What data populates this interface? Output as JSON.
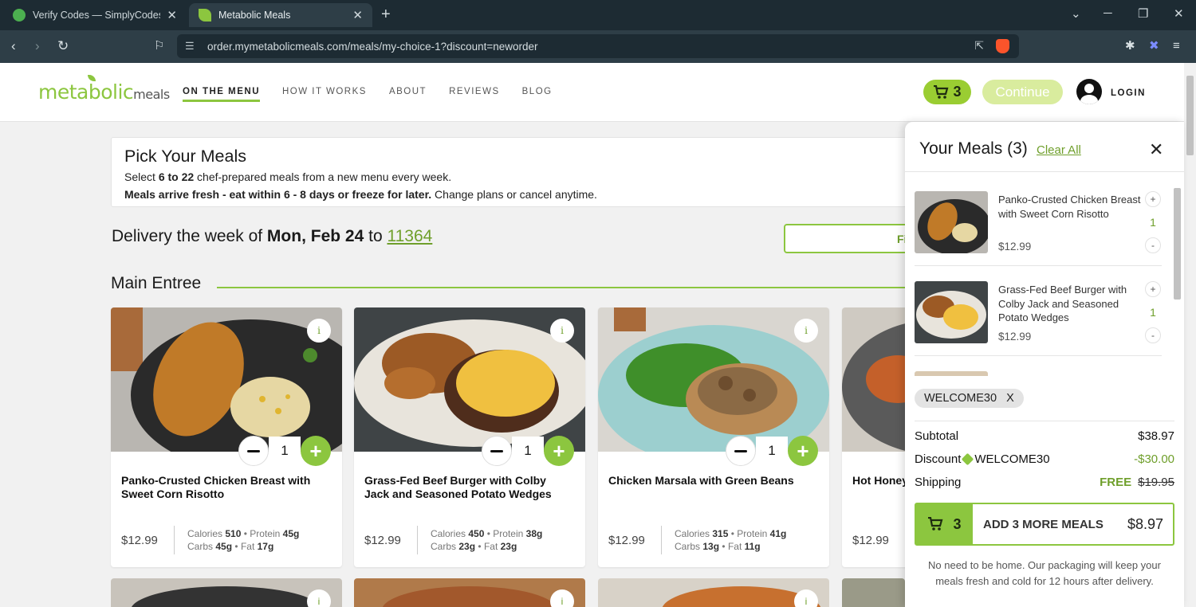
{
  "browser": {
    "tabs": [
      {
        "title": "Verify Codes — SimplyCodes",
        "icon_color": "#4caf50"
      },
      {
        "title": "Metabolic Meals",
        "icon_color": "#8cc63f"
      }
    ],
    "url": "order.mymetabolicmeals.com/meals/my-choice-1?discount=neworder"
  },
  "header": {
    "logo_main": "metabolic",
    "logo_sub": "meals",
    "nav": [
      "ON THE MENU",
      "HOW IT WORKS",
      "ABOUT",
      "REVIEWS",
      "BLOG"
    ],
    "cart_count": "3",
    "continue_label": "Continue",
    "login_label": "LOGIN"
  },
  "intro": {
    "title": "Pick Your Meals",
    "line1_pre": "Select ",
    "line1_bold": "6 to 22",
    "line1_post": " chef-prepared meals from a new menu every week.",
    "line2_bold": "Meals arrive fresh - eat within 6 - 8 days or freeze for later.",
    "line2_post": " Change plans or cancel anytime."
  },
  "delivery": {
    "pre": "Delivery the week of ",
    "date": "Mon, Feb 24",
    "mid": " to ",
    "zip": "11364",
    "filter_label": "Fi"
  },
  "section_title": "Main Entree",
  "meals": [
    {
      "name": "Panko-Crusted Chicken Breast with Sweet Corn Risotto",
      "price": "$12.99",
      "calories": "510",
      "protein": "45g",
      "carbs": "45g",
      "fat": "17g",
      "qty": "1"
    },
    {
      "name": "Grass-Fed Beef Burger with Colby Jack and Seasoned Potato Wedges",
      "price": "$12.99",
      "calories": "450",
      "protein": "38g",
      "carbs": "23g",
      "fat": "23g",
      "qty": "1"
    },
    {
      "name": "Chicken Marsala with Green Beans",
      "price": "$12.99",
      "calories": "315",
      "protein": "41g",
      "carbs": "13g",
      "fat": "11g",
      "qty": "1"
    },
    {
      "name": "Hot Honey Browned",
      "price": "$12.99"
    }
  ],
  "nutrition_labels": {
    "calories": "Calories",
    "protein": "Protein",
    "carbs": "Carbs",
    "fat": "Fat",
    "dot": "•",
    "info": "i"
  },
  "cart": {
    "title": "Your Meals (3)",
    "clear_all": "Clear All",
    "items": [
      {
        "name": "Panko-Crusted Chicken Breast with Sweet Corn Risotto",
        "price": "$12.99",
        "qty": "1"
      },
      {
        "name": "Grass-Fed Beef Burger with Colby Jack and Seasoned Potato Wedges",
        "price": "$12.99",
        "qty": "1"
      }
    ],
    "coupon_code": "WELCOME30",
    "subtotal_label": "Subtotal",
    "subtotal": "$38.97",
    "discount_label": "Discount",
    "discount_code": "WELCOME30",
    "discount": "-$30.00",
    "shipping_label": "Shipping",
    "shipping_free": "FREE",
    "shipping_old": "$19.95",
    "button_count": "3",
    "button_label": "ADD 3 MORE MEALS",
    "button_amount": "$8.97",
    "note": "No need to be home. Our packaging will keep your meals fresh and cold for 12 hours after delivery."
  },
  "colors": {
    "brand_green": "#8cc63f",
    "link_green": "#6f9f2b",
    "chrome_dark": "#1d2b33"
  }
}
